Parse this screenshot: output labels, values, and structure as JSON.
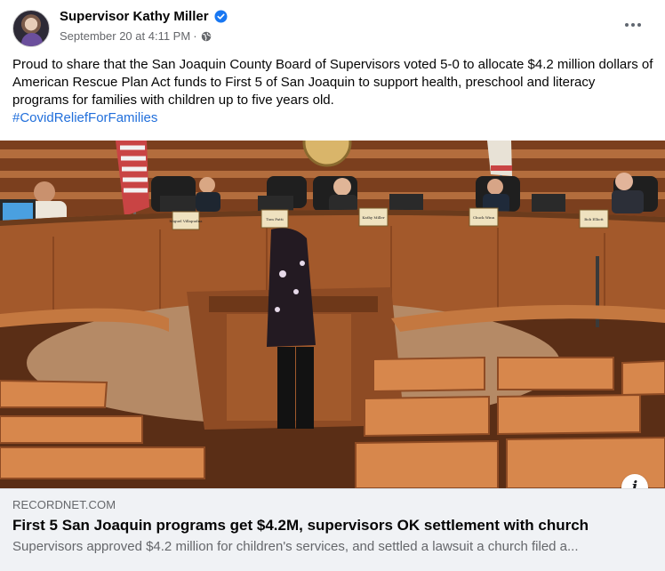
{
  "post": {
    "author": "Supervisor Kathy Miller",
    "verified": true,
    "timestamp": "September 20 at 4:11 PM",
    "separator": "·",
    "audience_icon": "globe-icon",
    "more_icon": "more-options-icon",
    "text": "Proud to share that the San Joaquin County Board of Supervisors voted 5-0 to allocate $4.2 million dollars of American Rescue Plan Act funds to First 5 of San Joaquin to support health, preschool and literacy programs for families with children up to five years old.",
    "hashtag": "#CovidReliefForFamilies"
  },
  "photo": {
    "nameplates": [
      "Miguel Villapudua",
      "Tom Patti",
      "Kathy Miller",
      "Chuck Winn",
      "Bob Elliott"
    ]
  },
  "link_preview": {
    "domain": "RECORDNET.COM",
    "title": "First 5 San Joaquin programs get $4.2M, supervisors OK settlement with church",
    "description": "Supervisors approved $4.2 million for children's services, and settled a lawsuit a church filed a...",
    "info_icon_label": "i"
  },
  "colors": {
    "link_blue": "#216fdb",
    "verified_blue": "#1877f2",
    "secondary_text": "#65676b",
    "preview_bg": "#f0f2f5"
  }
}
